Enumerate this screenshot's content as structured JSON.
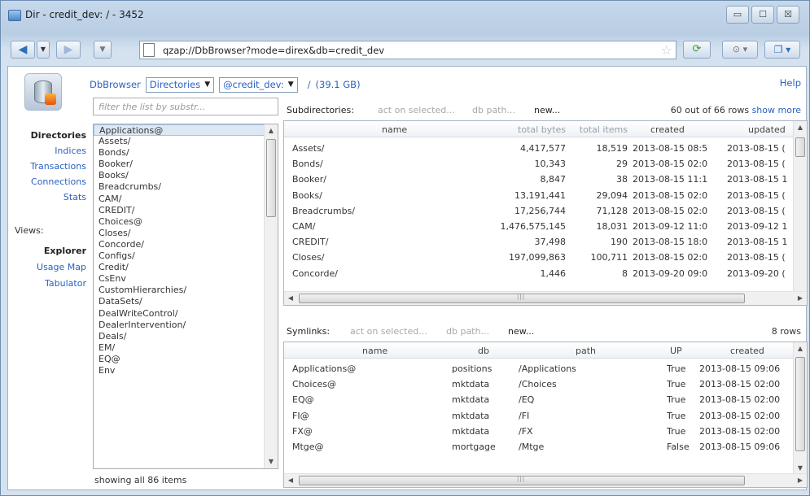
{
  "window": {
    "title": "Dir - credit_dev: / - 3452",
    "buttons": [
      "▭",
      "☐",
      "☒"
    ]
  },
  "navbar": {
    "address": "qzap://DbBrowser?mode=direx&db=credit_dev",
    "back_icon": "back-arrow-icon",
    "forward_icon": "forward-arrow-icon"
  },
  "breadcrumb": {
    "app": "DbBrowser",
    "mode": "Directories",
    "db": "@credit_dev:",
    "separator": "/",
    "size": "(39.1 GB)"
  },
  "help_label": "Help",
  "filter_placeholder": "filter the list by substr...",
  "left_nav": {
    "items": [
      "Directories",
      "Indices",
      "Transactions",
      "Connections",
      "Stats"
    ],
    "views_label": "Views:",
    "views": [
      "Explorer",
      "Usage Map",
      "Tabulator"
    ]
  },
  "dir_list": {
    "items": [
      "Applications@",
      "Assets/",
      "Bonds/",
      "Booker/",
      "Books/",
      "Breadcrumbs/",
      "CAM/",
      "CREDIT/",
      "Choices@",
      "Closes/",
      "Concorde/",
      "Configs/",
      "Credit/",
      "CsEnv",
      "CustomHierarchies/",
      "DataSets/",
      "DealWriteControl/",
      "DealerIntervention/",
      "Deals/",
      "EM/",
      "EQ@",
      "Env"
    ],
    "status": "showing all 86 items"
  },
  "subdirs": {
    "label": "Subdirectories:",
    "act_on_selected": "act on selected...",
    "db_path": "db path...",
    "new": "new...",
    "count": "60 out of 66 rows",
    "show_more": "show more",
    "columns": [
      "name",
      "total bytes",
      "total items",
      "created",
      "updated"
    ],
    "rows": [
      {
        "name": "Assets/",
        "bytes": "4,417,577",
        "items": "18,519",
        "created": "2013-08-15 08:5",
        "updated": "2013-08-15 ("
      },
      {
        "name": "Bonds/",
        "bytes": "10,343",
        "items": "29",
        "created": "2013-08-15 02:0",
        "updated": "2013-08-15 ("
      },
      {
        "name": "Booker/",
        "bytes": "8,847",
        "items": "38",
        "created": "2013-08-15 11:1",
        "updated": "2013-08-15 1"
      },
      {
        "name": "Books/",
        "bytes": "13,191,441",
        "items": "29,094",
        "created": "2013-08-15 02:0",
        "updated": "2013-08-15 ("
      },
      {
        "name": "Breadcrumbs/",
        "bytes": "17,256,744",
        "items": "71,128",
        "created": "2013-08-15 02:0",
        "updated": "2013-08-15 ("
      },
      {
        "name": "CAM/",
        "bytes": "1,476,575,145",
        "items": "18,031",
        "created": "2013-09-12 11:0",
        "updated": "2013-09-12 1"
      },
      {
        "name": "CREDIT/",
        "bytes": "37,498",
        "items": "190",
        "created": "2013-08-15 18:0",
        "updated": "2013-08-15 1"
      },
      {
        "name": "Closes/",
        "bytes": "197,099,863",
        "items": "100,711",
        "created": "2013-08-15 02:0",
        "updated": "2013-08-15 ("
      },
      {
        "name": "Concorde/",
        "bytes": "1,446",
        "items": "8",
        "created": "2013-09-20 09:0",
        "updated": "2013-09-20 ("
      }
    ]
  },
  "symlinks": {
    "label": "Symlinks:",
    "act_on_selected": "act on selected...",
    "db_path": "db path...",
    "new": "new...",
    "count": "8 rows",
    "columns": [
      "name",
      "db",
      "path",
      "UP",
      "created"
    ],
    "rows": [
      {
        "name": "Applications@",
        "db": "positions",
        "path": "/Applications",
        "up": "True",
        "created": "2013-08-15 09:06"
      },
      {
        "name": "Choices@",
        "db": "mktdata",
        "path": "/Choices",
        "up": "True",
        "created": "2013-08-15 02:00"
      },
      {
        "name": "EQ@",
        "db": "mktdata",
        "path": "/EQ",
        "up": "True",
        "created": "2013-08-15 02:00"
      },
      {
        "name": "FI@",
        "db": "mktdata",
        "path": "/FI",
        "up": "True",
        "created": "2013-08-15 02:00"
      },
      {
        "name": "FX@",
        "db": "mktdata",
        "path": "/FX",
        "up": "True",
        "created": "2013-08-15 02:00"
      },
      {
        "name": "Mtge@",
        "db": "mortgage",
        "path": "/Mtge",
        "up": "False",
        "created": "2013-08-15 09:06"
      }
    ]
  }
}
